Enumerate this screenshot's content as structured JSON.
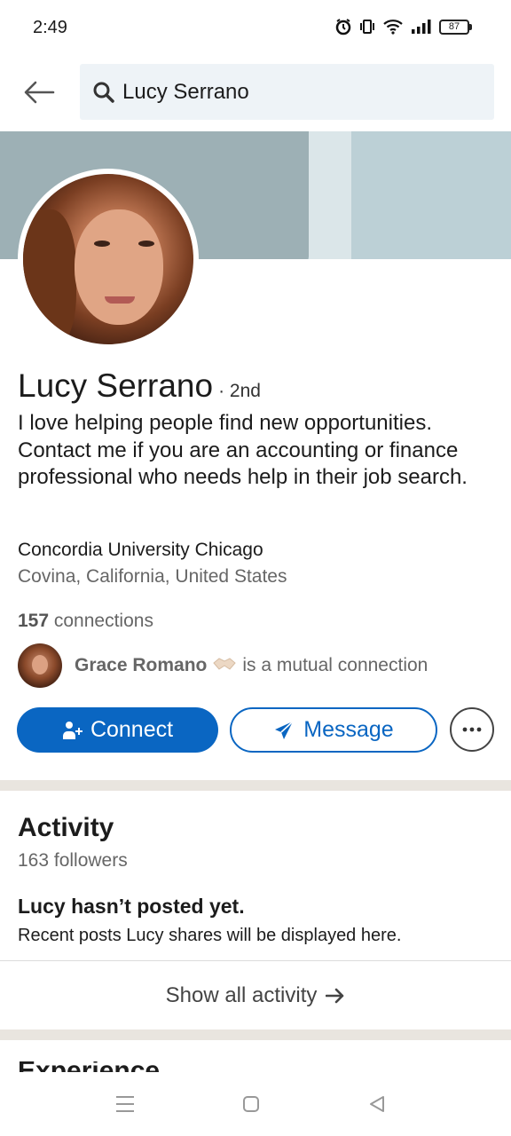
{
  "status_bar": {
    "time": "2:49",
    "battery": "87"
  },
  "search": {
    "query": "Lucy Serrano"
  },
  "profile": {
    "name": "Lucy Serrano",
    "degree": "· 2nd",
    "headline": "I love helping people find new opportunities. Contact me if you are an accounting or finance professional who needs help in their job search.",
    "school": "Concordia University Chicago",
    "location": "Covina, California, United States",
    "connections_count": "157",
    "connections_label": " connections",
    "mutual_name": "Grace Romano",
    "mutual_text": "is a mutual connection"
  },
  "actions": {
    "connect_label": "Connect",
    "message_label": "Message"
  },
  "activity": {
    "title": "Activity",
    "followers": "163 followers",
    "empty_title": "Lucy hasn’t posted yet.",
    "empty_subtitle": "Recent posts Lucy shares will be displayed here.",
    "show_all_label": "Show all activity"
  },
  "next_section": {
    "title": "Experience"
  },
  "colors": {
    "brand_blue": "#0a66c2",
    "banner": "#bcd0d6",
    "divider": "#e9e5df"
  },
  "icons": [
    "alarm-icon",
    "vibrate-icon",
    "wifi-icon",
    "signal-icon",
    "battery-icon",
    "back-arrow-icon",
    "search-icon",
    "add-person-icon",
    "send-icon",
    "more-icon",
    "handshake-icon",
    "arrow-right-icon",
    "menu-icon",
    "home-icon",
    "back-icon"
  ]
}
